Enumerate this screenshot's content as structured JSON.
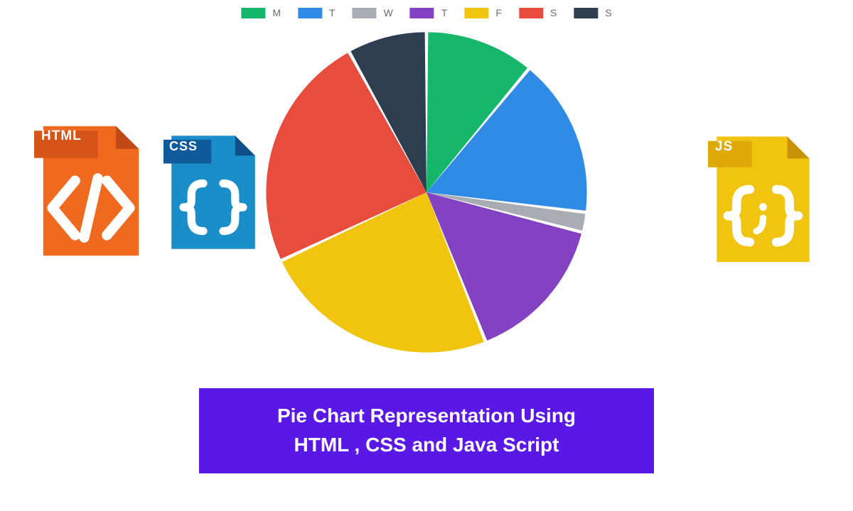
{
  "chart_data": {
    "type": "pie",
    "categories": [
      "M",
      "T",
      "W",
      "T",
      "F",
      "S",
      "S"
    ],
    "values": [
      11,
      16,
      2,
      15,
      24,
      24,
      8
    ],
    "series_colors": [
      "#17b76b",
      "#2f8be6",
      "#a7adb3",
      "#8342c1",
      "#f1c40f",
      "#e74c3c",
      "#2c3e50"
    ],
    "title": "",
    "legend_position": "top"
  },
  "legend": {
    "items": [
      {
        "label": "M",
        "color": "#17b76b"
      },
      {
        "label": "T",
        "color": "#2f8be6"
      },
      {
        "label": "W",
        "color": "#a7adb3"
      },
      {
        "label": "T",
        "color": "#8342c1"
      },
      {
        "label": "F",
        "color": "#f1c40f"
      },
      {
        "label": "S",
        "color": "#e74c3c"
      },
      {
        "label": "S",
        "color": "#2c3e50"
      }
    ]
  },
  "file_icons": {
    "html": {
      "badge": "HTML",
      "bg": "#ef6a1f",
      "badge_bg": "#d4541a",
      "fold": "#c04a17"
    },
    "css": {
      "badge": "CSS",
      "bg": "#1a8ec9",
      "badge_bg": "#0f5a9a",
      "fold": "#0e4f88"
    },
    "js": {
      "badge": "JS",
      "bg": "#f1c40f",
      "badge_bg": "#e0a90a",
      "fold": "#c99308"
    }
  },
  "banner": {
    "line1": "Pie Chart Representation Using",
    "line2": "HTML , CSS and Java Script"
  }
}
